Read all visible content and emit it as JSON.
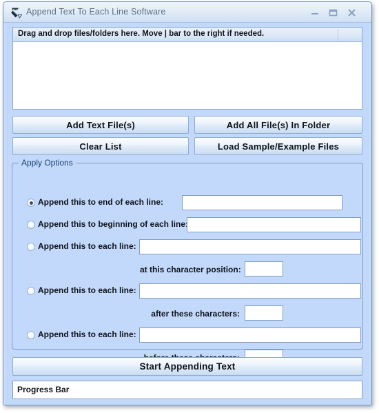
{
  "window": {
    "title": "Append Text To Each Line Software",
    "icon": "app-icon",
    "controls": {
      "minimize": "minimize-icon",
      "maximize": "maximize-icon",
      "close": "close-icon"
    }
  },
  "file_list": {
    "column_header": "Drag and drop files/folders here. Move | bar to the right if needed.",
    "rows": []
  },
  "buttons": {
    "add_text_files": "Add Text File(s)",
    "add_all_files_in_folder": "Add All File(s) In Folder",
    "clear_list": "Clear List",
    "load_sample_files": "Load Sample/Example Files",
    "start": "Start Appending Text"
  },
  "apply_options": {
    "title": "Apply Options",
    "rows": [
      {
        "label": "Append this to end of each line:",
        "selected": true,
        "value": "",
        "sub_label": null,
        "sub_value": null
      },
      {
        "label": "Append this to beginning of each line:",
        "selected": false,
        "value": "",
        "sub_label": null,
        "sub_value": null
      },
      {
        "label": "Append this to each line:",
        "selected": false,
        "value": "",
        "sub_label": "at this character position:",
        "sub_value": ""
      },
      {
        "label": "Append this to each line:",
        "selected": false,
        "value": "",
        "sub_label": "after these characters:",
        "sub_value": ""
      },
      {
        "label": "Append this to each line:",
        "selected": false,
        "value": "",
        "sub_label": "before these characters:",
        "sub_value": ""
      }
    ]
  },
  "progress": {
    "label": "Progress Bar",
    "percent": 0
  },
  "colors": {
    "window_background": "#c2d9fc",
    "title_text": "#5c6f86",
    "group_title": "#1b3f73",
    "border": "#7d9ec6",
    "field_background": "#ffffff"
  }
}
